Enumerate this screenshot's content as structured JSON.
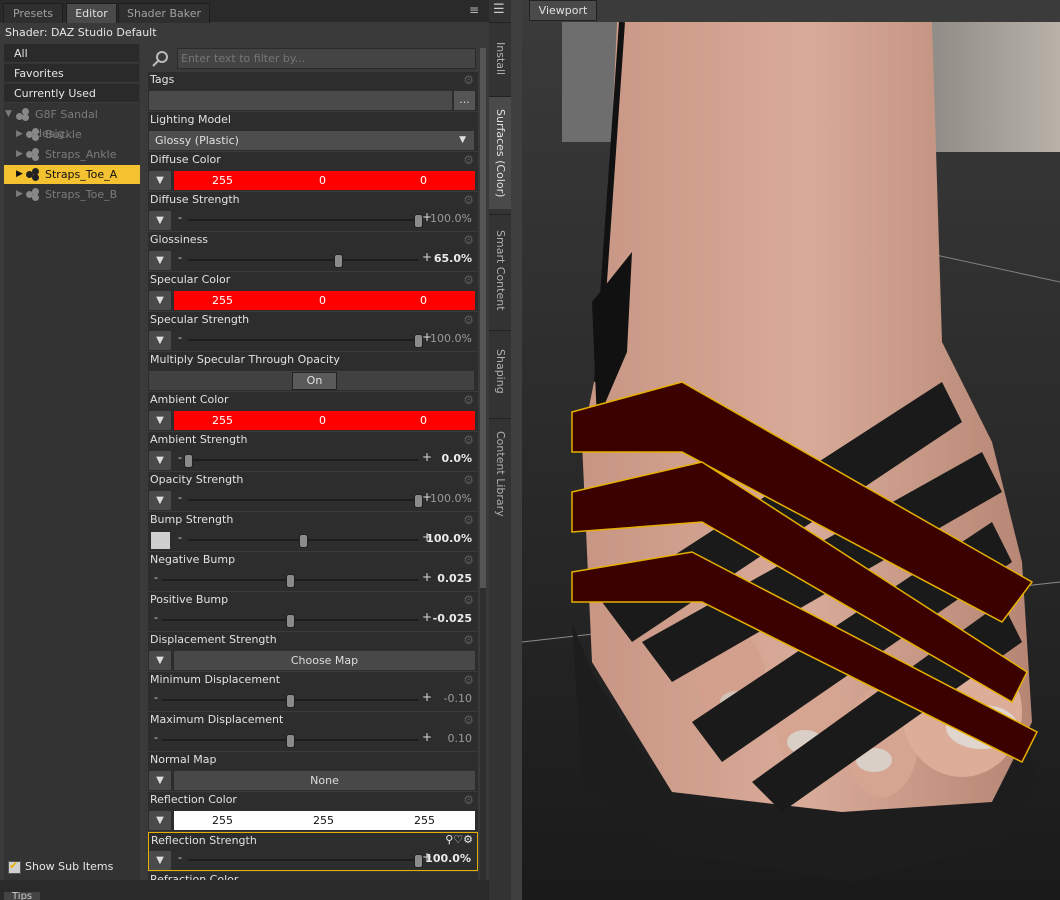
{
  "tabs": [
    "Presets",
    "Editor",
    "Shader Baker"
  ],
  "active_tab": "Editor",
  "shader_label": "Shader: DAZ Studio Default",
  "categories": [
    "All",
    "Favorites",
    "Currently Used"
  ],
  "tree": {
    "root": "G8F Sandal desig...",
    "items": [
      "Buckle",
      "Straps_Ankle",
      "Straps_Toe_A",
      "Straps_Toe_B"
    ],
    "selected": "Straps_Toe_A"
  },
  "show_sub_items": "Show Sub Items",
  "filter_placeholder": "Enter text to filter by...",
  "properties": {
    "tags": "Tags",
    "tags_btn": "...",
    "lighting_model": "Lighting Model",
    "lighting_value": "Glossy (Plastic)",
    "diffuse_color": "Diffuse Color",
    "diffuse_rgb": [
      "255",
      "0",
      "0"
    ],
    "diffuse_strength": "Diffuse Strength",
    "diffuse_strength_val": "100.0%",
    "glossiness": "Glossiness",
    "glossiness_val": "65.0%",
    "specular_color": "Specular Color",
    "specular_rgb": [
      "255",
      "0",
      "0"
    ],
    "specular_strength": "Specular Strength",
    "specular_strength_val": "100.0%",
    "mult_spec": "Multiply Specular Through Opacity",
    "mult_spec_val": "On",
    "ambient_color": "Ambient Color",
    "ambient_rgb": [
      "255",
      "0",
      "0"
    ],
    "ambient_strength": "Ambient Strength",
    "ambient_strength_val": "0.0%",
    "opacity_strength": "Opacity Strength",
    "opacity_strength_val": "100.0%",
    "bump_strength": "Bump Strength",
    "bump_strength_val": "100.0%",
    "negative_bump": "Negative Bump",
    "negative_bump_val": "0.025",
    "positive_bump": "Positive Bump",
    "positive_bump_val": "-0.025",
    "displacement_strength": "Displacement Strength",
    "choose_map": "Choose Map",
    "min_disp": "Minimum Displacement",
    "min_disp_val": "-0.10",
    "max_disp": "Maximum Displacement",
    "max_disp_val": "0.10",
    "normal_map": "Normal Map",
    "normal_map_val": "None",
    "reflection_color": "Reflection Color",
    "reflection_rgb": [
      "255",
      "255",
      "255"
    ],
    "reflection_strength": "Reflection Strength",
    "reflection_strength_val": "100.0%",
    "refraction_color": "Refraction Color"
  },
  "side_tabs": [
    "Install",
    "Surfaces (Color)",
    "Smart Content",
    "Shaping",
    "Content Library"
  ],
  "viewport_label": "Viewport",
  "tips_label": "Tips",
  "slider_levels": {
    "diffuse_strength": 1.0,
    "glossiness": 0.65,
    "specular_strength": 1.0,
    "ambient_strength": 0.0,
    "opacity_strength": 1.0,
    "bump_strength": 0.5,
    "negative_bump": 0.5,
    "positive_bump": 0.5,
    "min_disp": 0.5,
    "max_disp": 0.5,
    "reflection_strength": 1.0
  }
}
